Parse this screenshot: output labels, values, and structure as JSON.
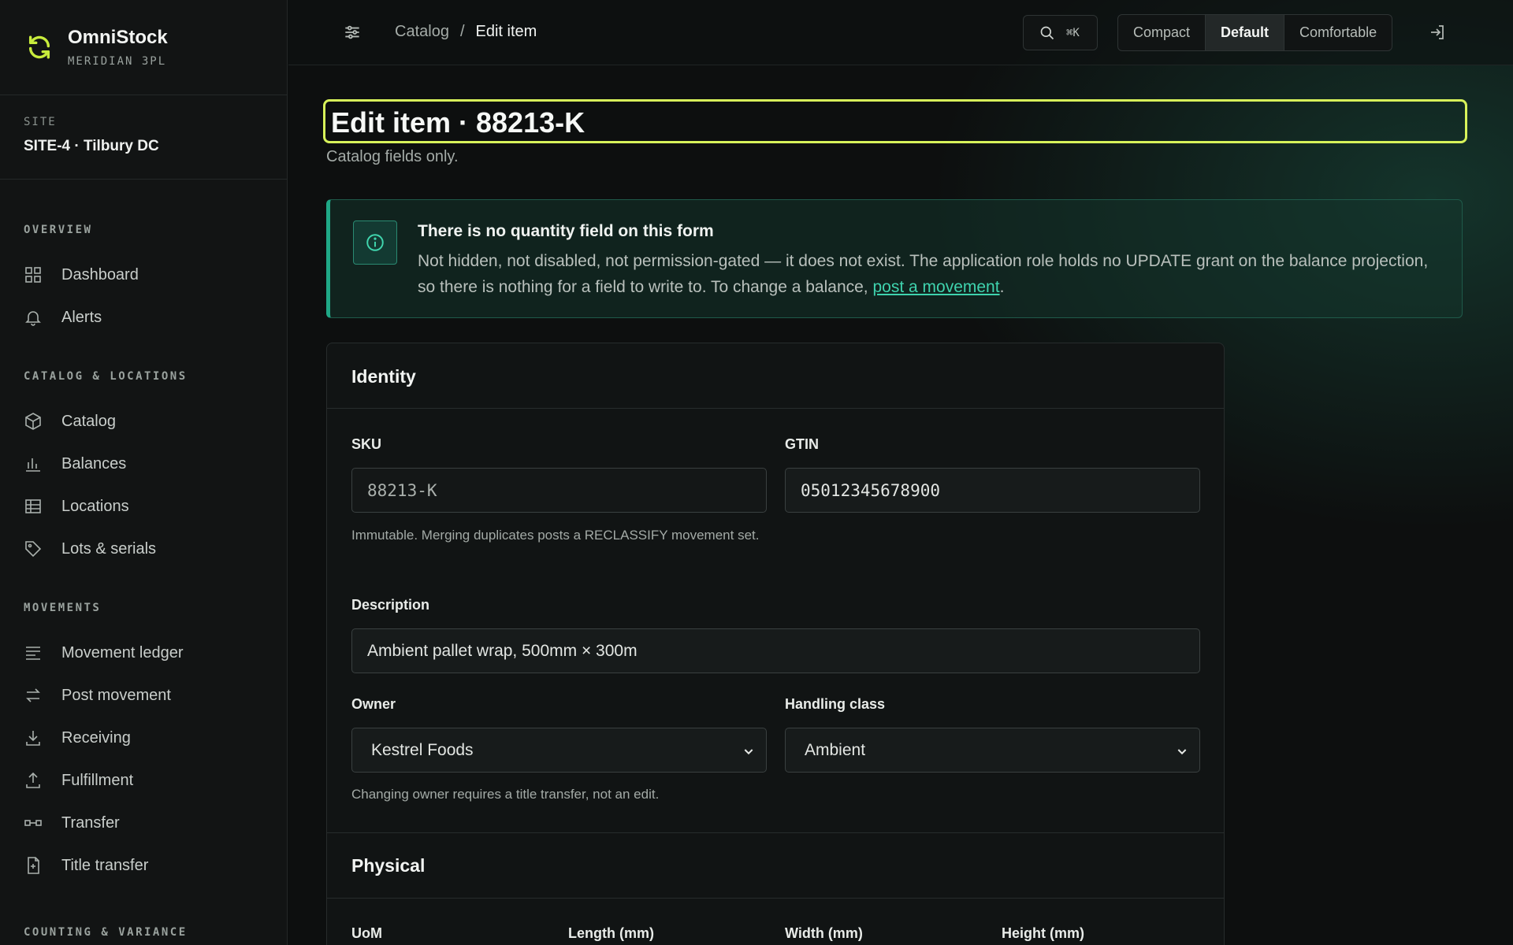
{
  "brand": {
    "name": "OmniStock",
    "subtitle": "MERIDIAN 3PL"
  },
  "site": {
    "label": "SITE",
    "name": "SITE-4 · Tilbury DC"
  },
  "nav": {
    "overview": {
      "heading": "OVERVIEW",
      "items": [
        {
          "label": "Dashboard",
          "icon": "grid-icon"
        },
        {
          "label": "Alerts",
          "icon": "bell-icon"
        }
      ]
    },
    "catalog": {
      "heading": "CATALOG & LOCATIONS",
      "items": [
        {
          "label": "Catalog",
          "icon": "box-icon"
        },
        {
          "label": "Balances",
          "icon": "bar-chart-icon"
        },
        {
          "label": "Locations",
          "icon": "table-icon"
        },
        {
          "label": "Lots & serials",
          "icon": "tag-icon"
        }
      ]
    },
    "movements": {
      "heading": "MOVEMENTS",
      "items": [
        {
          "label": "Movement ledger",
          "icon": "lines-icon"
        },
        {
          "label": "Post movement",
          "icon": "arrows-icon"
        },
        {
          "label": "Receiving",
          "icon": "download-icon"
        },
        {
          "label": "Fulfillment",
          "icon": "upload-icon"
        },
        {
          "label": "Transfer",
          "icon": "transfer-icon"
        },
        {
          "label": "Title transfer",
          "icon": "document-icon"
        }
      ]
    },
    "counting": {
      "heading": "COUNTING & VARIANCE"
    }
  },
  "topbar": {
    "breadcrumb": {
      "parent": "Catalog",
      "separator": "/",
      "current": "Edit item"
    },
    "search_shortcut": "⌘K",
    "density": {
      "options": [
        "Compact",
        "Default",
        "Comfortable"
      ],
      "selected": "Default"
    }
  },
  "page": {
    "title": "Edit item · 88213-K",
    "subtitle": "Catalog fields only."
  },
  "alert": {
    "title": "There is no quantity field on this form",
    "body": "Not hidden, not disabled, not permission-gated — it does not exist. The application role holds no UPDATE grant on the balance projection, so there is nothing for a field to write to. To change a balance, ",
    "link": "post a movement",
    "end": "."
  },
  "identity": {
    "heading": "Identity",
    "sku": {
      "label": "SKU",
      "value": "88213-K",
      "help": "Immutable. Merging duplicates posts a RECLASSIFY movement set."
    },
    "gtin": {
      "label": "GTIN",
      "value": "05012345678900"
    },
    "description": {
      "label": "Description",
      "value": "Ambient pallet wrap, 500mm × 300m"
    },
    "owner": {
      "label": "Owner",
      "value": "Kestrel Foods",
      "help": "Changing owner requires a title transfer, not an edit."
    },
    "handling": {
      "label": "Handling class",
      "value": "Ambient"
    }
  },
  "physical": {
    "heading": "Physical",
    "uom_label": "UoM",
    "length_label": "Length (mm)",
    "width_label": "Width (mm)",
    "height_label": "Height (mm)"
  },
  "colors": {
    "accent": "#d7f25a",
    "teal": "#1fa886",
    "link": "#3fd3ae"
  }
}
